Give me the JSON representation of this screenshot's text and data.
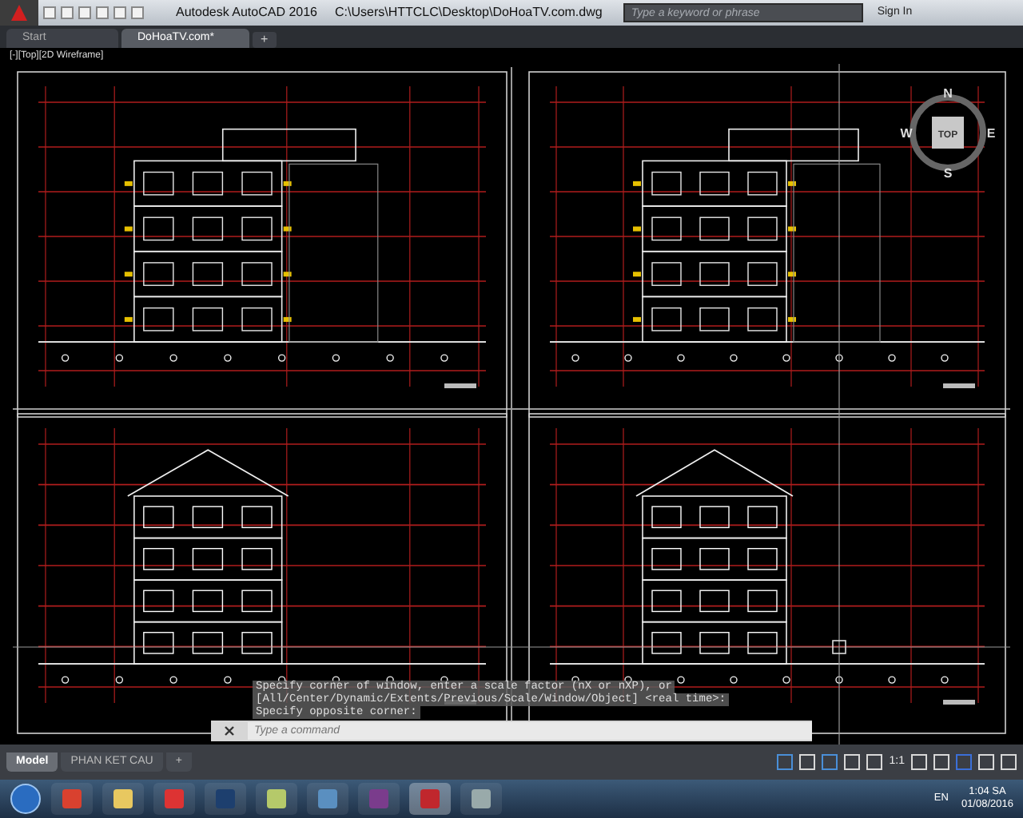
{
  "window": {
    "title": "Autodesk AutoCAD 2016",
    "file_path": "C:\\Users\\HTTCLC\\Desktop\\DoHoaTV.com.dwg"
  },
  "search": {
    "placeholder": "Type a keyword or phrase"
  },
  "account": {
    "label": "Sign In"
  },
  "tabs": [
    {
      "label": "Start",
      "selected": false
    },
    {
      "label": "DoHoaTV.com*",
      "selected": true
    }
  ],
  "new_tab_button": "+",
  "viewport_label": "[-][Top][2D Wireframe]",
  "sheets": [
    {
      "kind": "flat"
    },
    {
      "kind": "flat"
    },
    {
      "kind": "gable"
    },
    {
      "kind": "gable"
    }
  ],
  "view_cube": {
    "face": "TOP",
    "north": "N",
    "south": "S",
    "east": "E",
    "west": "W"
  },
  "command_history": [
    "Specify corner of window, enter a scale factor (nX or nXP), or",
    "[All/Center/Dynamic/Extents/Previous/Scale/Window/Object] <real time>:",
    "Specify opposite corner:"
  ],
  "command_line": {
    "placeholder": "Type a command"
  },
  "layout_tabs": [
    {
      "label": "Model",
      "selected": true
    },
    {
      "label": "PHAN KET CAU",
      "selected": false
    }
  ],
  "new_layout_button": "+",
  "status_bar": {
    "scale": "1:1"
  },
  "taskbar": {
    "language": "EN",
    "time": "1:04 SA",
    "date": "01/08/2016"
  }
}
